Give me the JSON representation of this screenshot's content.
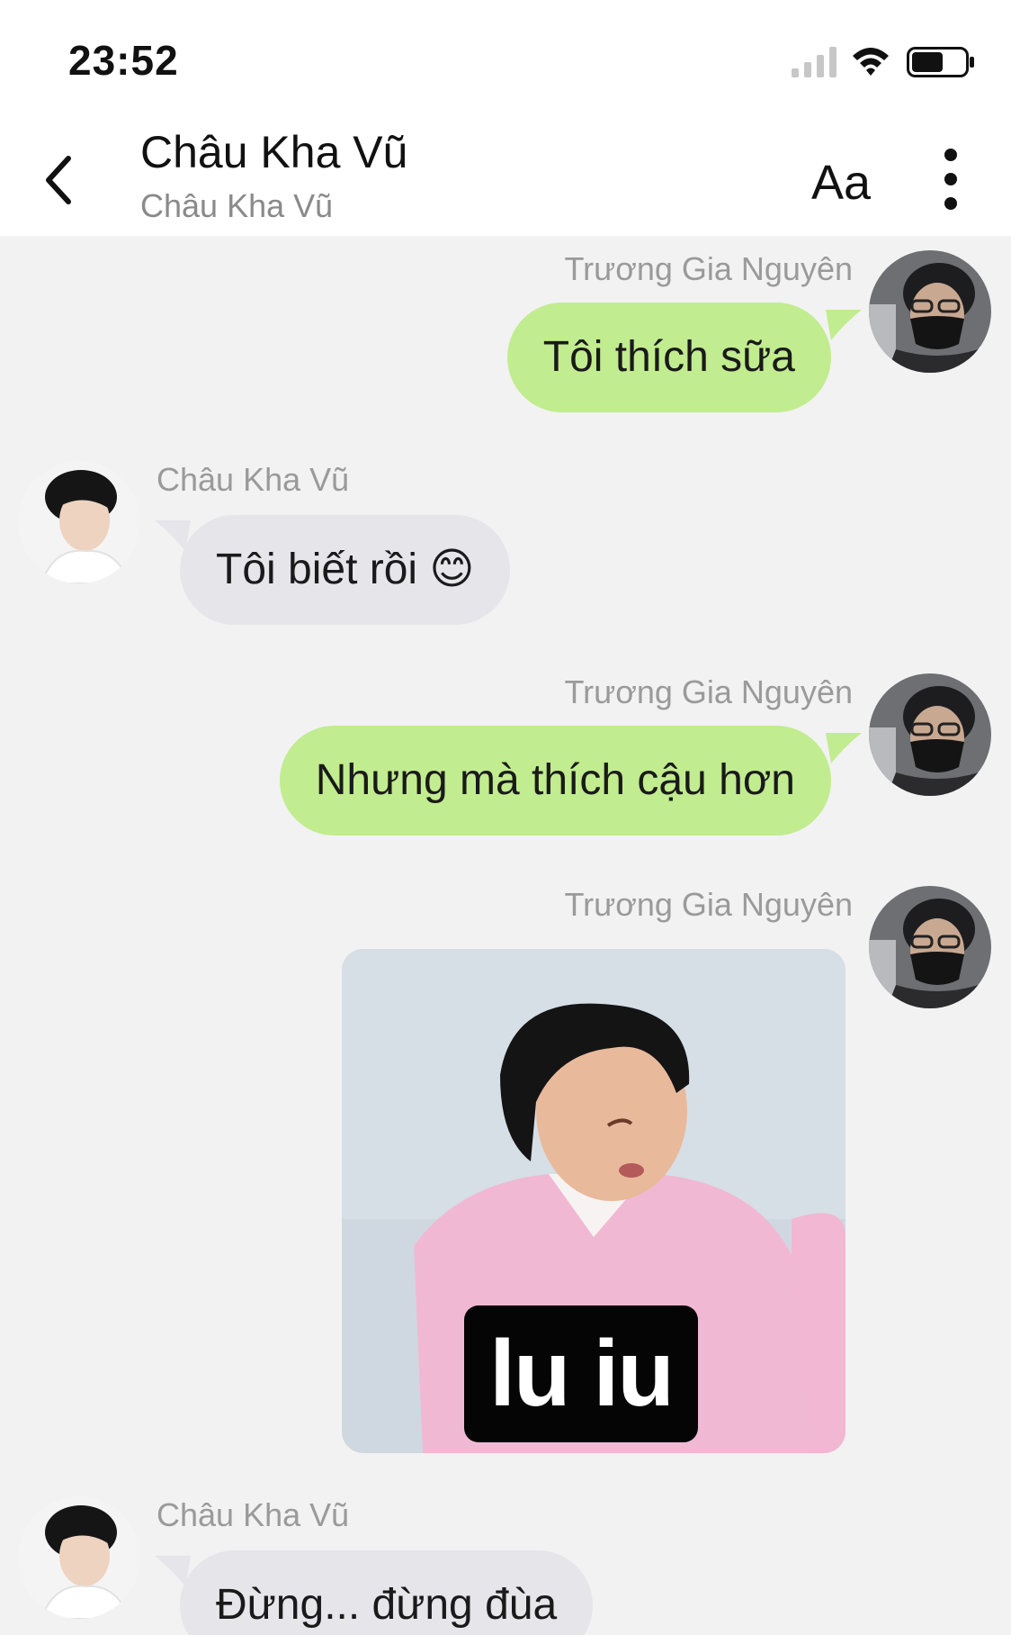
{
  "status_bar": {
    "time": "23:52",
    "signal_icon": "cellular-signal-icon",
    "wifi_icon": "wifi-icon",
    "battery_icon": "battery-icon",
    "battery_level": 0.6
  },
  "header": {
    "back_icon": "chevron-left-icon",
    "title": "Châu Kha Vũ",
    "subtitle": "Châu Kha Vũ",
    "font_button": "Aa",
    "more_icon": "vertical-ellipsis-icon"
  },
  "colors": {
    "outgoing_bubble": "#c1ec8f",
    "incoming_bubble": "#e5e5ea",
    "background": "#f2f2f2"
  },
  "messages": [
    {
      "sender": "Trương Gia Nguyên",
      "direction": "outgoing",
      "type": "text",
      "text": "Tôi thích sữa"
    },
    {
      "sender": "Châu Kha Vũ",
      "direction": "incoming",
      "type": "text",
      "text": "Tôi biết rồi 😊"
    },
    {
      "sender": "Trương Gia Nguyên",
      "direction": "outgoing",
      "type": "text",
      "text": "Nhưng mà thích cậu hơn"
    },
    {
      "sender": "Trương Gia Nguyên",
      "direction": "outgoing",
      "type": "sticker",
      "caption": "lu iu"
    },
    {
      "sender": "Châu Kha Vũ",
      "direction": "incoming",
      "type": "text",
      "text": "Đừng... đừng đùa"
    }
  ]
}
